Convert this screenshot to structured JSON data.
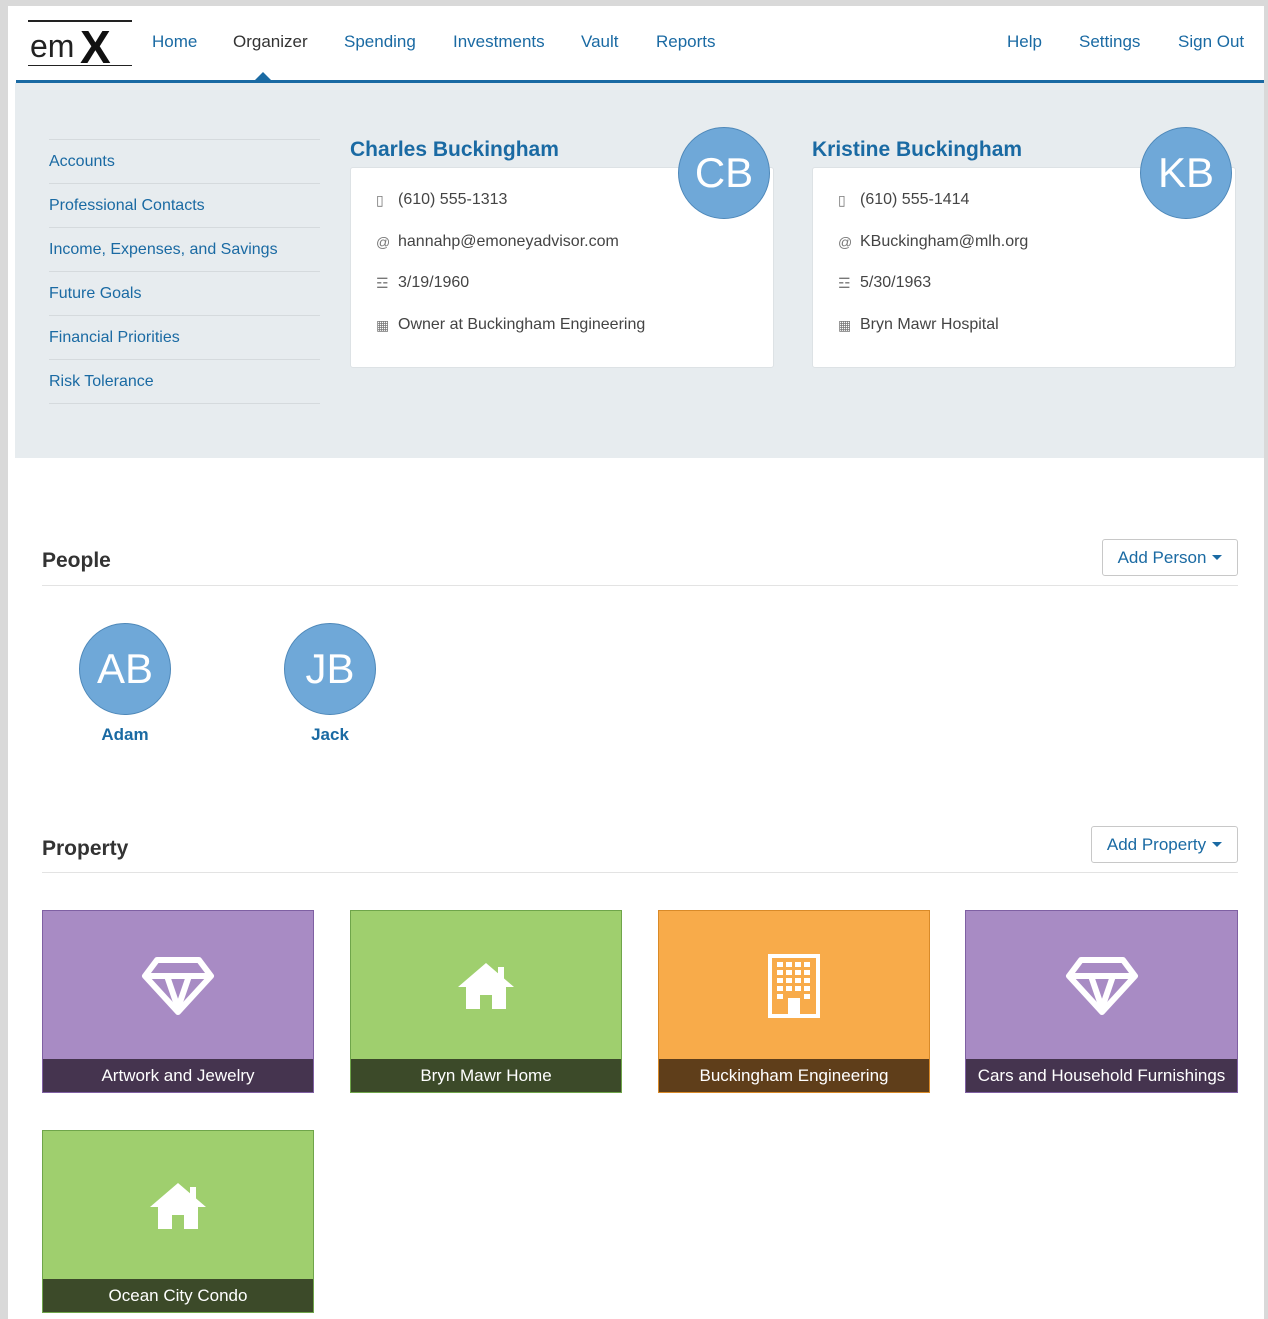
{
  "nav": {
    "logo_em": "em",
    "logo_x": "X",
    "links": [
      {
        "label": "Home"
      },
      {
        "label": "Organizer"
      },
      {
        "label": "Spending"
      },
      {
        "label": "Investments"
      },
      {
        "label": "Vault"
      },
      {
        "label": "Reports"
      }
    ],
    "right_links": [
      {
        "label": "Help"
      },
      {
        "label": "Settings"
      },
      {
        "label": "Sign Out"
      }
    ],
    "active": "Organizer"
  },
  "sidebar": {
    "items": [
      {
        "label": "Accounts"
      },
      {
        "label": "Professional Contacts"
      },
      {
        "label": "Income, Expenses, and Savings"
      },
      {
        "label": "Future Goals"
      },
      {
        "label": "Financial Priorities"
      },
      {
        "label": "Risk Tolerance"
      }
    ]
  },
  "clients": [
    {
      "name": "Charles Buckingham",
      "initials": "CB",
      "phone": "(610) 555-1313",
      "email": "hannahp@emoneyadvisor.com",
      "birthday": "3/19/1960",
      "employment": "Owner at Buckingham Engineering"
    },
    {
      "name": "Kristine Buckingham",
      "initials": "KB",
      "phone": "(610) 555-1414",
      "email": "KBuckingham@mlh.org",
      "birthday": "5/30/1963",
      "employment": "Bryn Mawr Hospital"
    }
  ],
  "people": {
    "title": "People",
    "add_label": "Add Person",
    "items": [
      {
        "initials": "AB",
        "name": "Adam"
      },
      {
        "initials": "JB",
        "name": "Jack"
      }
    ]
  },
  "property": {
    "title": "Property",
    "add_label": "Add Property",
    "items": [
      {
        "label": "Artwork and Jewelry",
        "icon": "diamond-icon",
        "color": "#a88bc4"
      },
      {
        "label": "Bryn Mawr Home",
        "icon": "home-icon",
        "color": "#9fcf6e"
      },
      {
        "label": "Buckingham Engineering",
        "icon": "building-icon",
        "color": "#f8ab4a"
      },
      {
        "label": "Cars and Household Furnishings",
        "icon": "diamond-icon",
        "color": "#a88bc4"
      },
      {
        "label": "Ocean City Condo",
        "icon": "home-icon",
        "color": "#9fcf6e"
      }
    ]
  },
  "colors": {
    "accent": "#1a6aa3",
    "avatar": "#6fa8d8",
    "header_band": "#e7ecef"
  }
}
